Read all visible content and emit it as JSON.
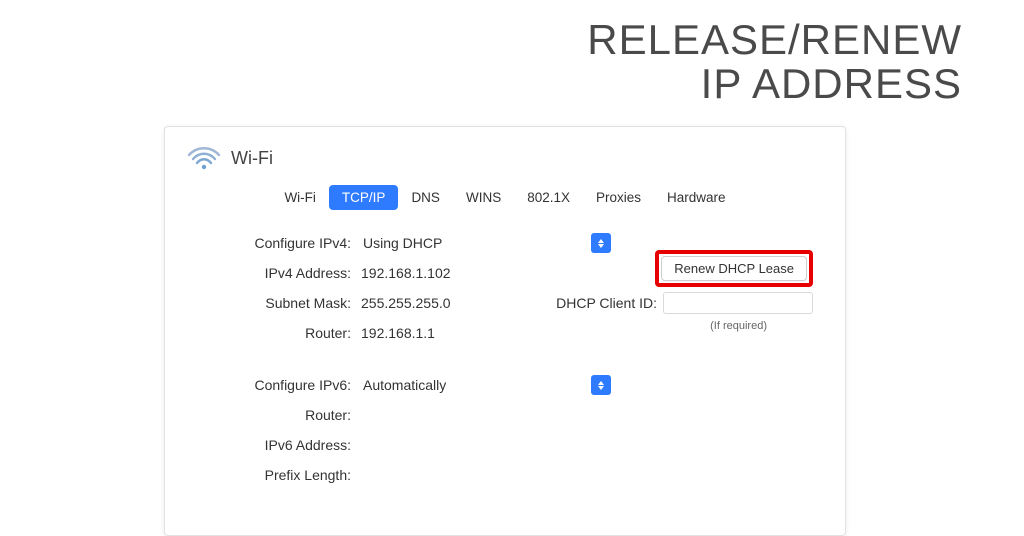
{
  "page": {
    "title_line1": "RELEASE/RENEW",
    "title_line2": "IP ADDRESS"
  },
  "panel": {
    "title": "Wi-Fi"
  },
  "tabs": [
    {
      "label": "Wi-Fi",
      "active": false
    },
    {
      "label": "TCP/IP",
      "active": true
    },
    {
      "label": "DNS",
      "active": false
    },
    {
      "label": "WINS",
      "active": false
    },
    {
      "label": "802.1X",
      "active": false
    },
    {
      "label": "Proxies",
      "active": false
    },
    {
      "label": "Hardware",
      "active": false
    }
  ],
  "ipv4": {
    "configure_label": "Configure IPv4:",
    "configure_value": "Using DHCP",
    "address_label": "IPv4 Address:",
    "address_value": "192.168.1.102",
    "subnet_label": "Subnet Mask:",
    "subnet_value": "255.255.255.0",
    "router_label": "Router:",
    "router_value": "192.168.1.1"
  },
  "dhcp": {
    "renew_button": "Renew DHCP Lease",
    "client_id_label": "DHCP Client ID:",
    "client_id_value": "",
    "if_required": "(If required)"
  },
  "ipv6": {
    "configure_label": "Configure IPv6:",
    "configure_value": "Automatically",
    "router_label": "Router:",
    "router_value": "",
    "address_label": "IPv6 Address:",
    "address_value": "",
    "prefix_label": "Prefix Length:",
    "prefix_value": ""
  }
}
